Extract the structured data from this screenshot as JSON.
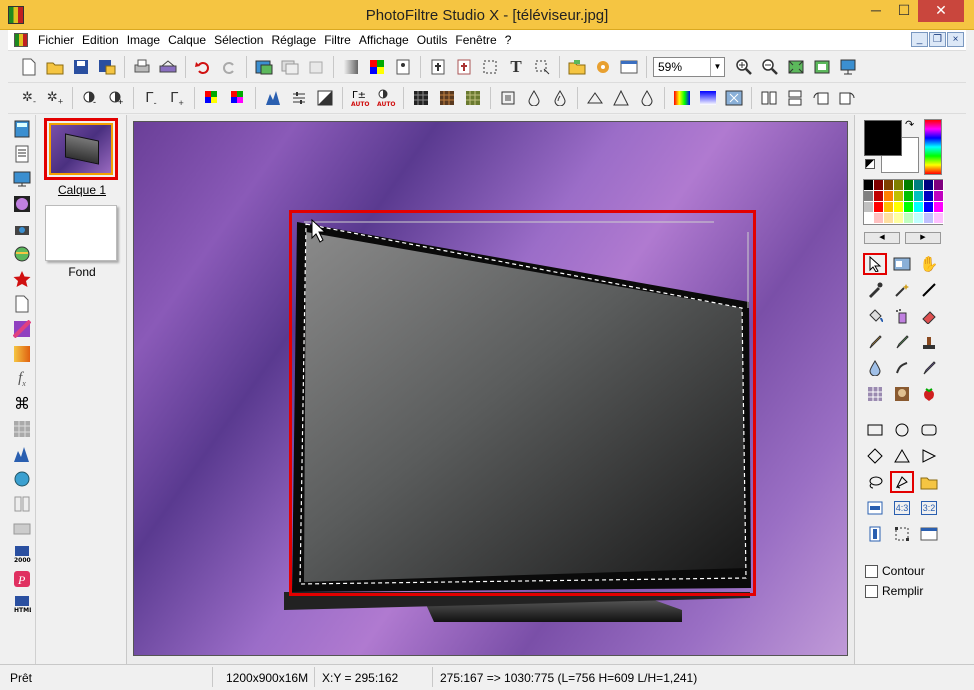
{
  "window": {
    "title": "PhotoFiltre Studio X - [téléviseur.jpg]",
    "minimize": "─",
    "maximize": "☐",
    "close": "✕"
  },
  "menu": {
    "items": [
      "Fichier",
      "Edition",
      "Image",
      "Calque",
      "Sélection",
      "Réglage",
      "Filtre",
      "Affichage",
      "Outils",
      "Fenêtre",
      "?"
    ],
    "mdi_min": "_",
    "mdi_restore": "❐",
    "mdi_close": "×"
  },
  "toolbar": {
    "zoom": "59%",
    "text_tool": "T"
  },
  "layers": {
    "items": [
      {
        "name": "Calque 1",
        "selected": true
      },
      {
        "name": "Fond",
        "selected": false
      }
    ]
  },
  "toolbox": {
    "palette_colors": [
      "#000000",
      "#800000",
      "#804000",
      "#808000",
      "#008000",
      "#008080",
      "#000080",
      "#800080",
      "#808080",
      "#c00000",
      "#ff8000",
      "#c0c000",
      "#00c000",
      "#00c0c0",
      "#0000c0",
      "#c000c0",
      "#c0c0c0",
      "#ff0000",
      "#ffc000",
      "#ffff00",
      "#00ff00",
      "#00ffff",
      "#0000ff",
      "#ff00ff",
      "#ffffff",
      "#ffc0c0",
      "#ffe0a0",
      "#ffffa0",
      "#c0ffc0",
      "#c0ffff",
      "#c0c0ff",
      "#ffc0ff"
    ],
    "contour_label": "Contour",
    "remplir_label": "Remplir",
    "ratio_label": "4:3",
    "ratio2_label": "3:2"
  },
  "status": {
    "state": "Prêt",
    "image_size": "1200x900x16M",
    "coords": "X:Y = 295:162",
    "selection": "275:167 => 1030:775 (L=756  H=609  L/H=1,241)"
  },
  "colors": {
    "titlebar": "#f5c542",
    "highlight": "#e30000"
  }
}
